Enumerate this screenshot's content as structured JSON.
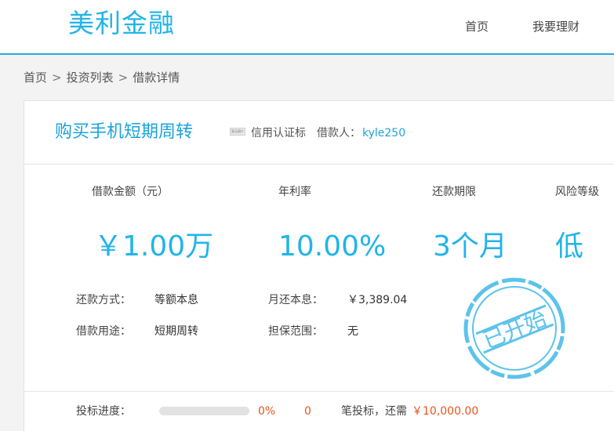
{
  "header": {
    "logo": "美利金融",
    "nav": [
      {
        "label": "首页"
      },
      {
        "label": "我要理财"
      }
    ]
  },
  "breadcrumb": {
    "items": [
      "首页",
      "投资列表",
      "借款详情"
    ],
    "separator": ">"
  },
  "loan": {
    "title": "购买手机短期周转",
    "cert_badge_alt": "暂无图片",
    "cert_label": "信用认证标",
    "borrower_label": "借款人：",
    "borrower_name": "kyle250"
  },
  "stats": [
    {
      "label": "借款金额（元）",
      "value": "￥1.00万"
    },
    {
      "label": "年利率",
      "value": "10.00%"
    },
    {
      "label": "还款期限",
      "value": "3个月"
    },
    {
      "label": "风险等级",
      "value": "低"
    }
  ],
  "details": {
    "repay_method_label": "还款方式：",
    "repay_method_value": "等额本息",
    "monthly_label": "月还本息：",
    "monthly_value": "￥3,389.04",
    "purpose_label": "借款用途：",
    "purpose_value": "短期周转",
    "guarantee_label": "担保范围：",
    "guarantee_value": "无"
  },
  "stamp": {
    "text": "已开始"
  },
  "progress": {
    "label": "投标进度：",
    "percent_text": "0%",
    "percent": 0,
    "bid_count": "0",
    "bid_suffix": "笔投标，还需",
    "remaining": "￥10,000.00"
  },
  "colors": {
    "accent": "#21b4e9",
    "highlight": "#e8541c"
  }
}
